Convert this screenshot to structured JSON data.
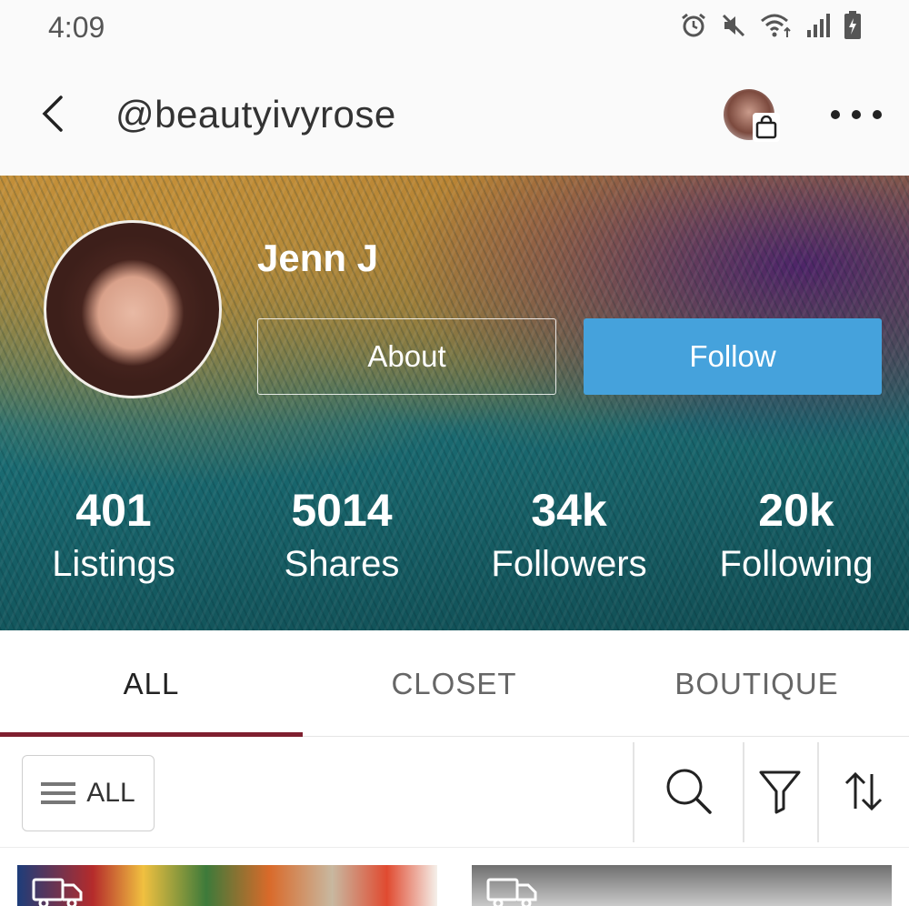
{
  "status_bar": {
    "time": "4:09",
    "icons": [
      "alarm-icon",
      "mute-icon",
      "wifi-icon",
      "signal-icon",
      "battery-charging-icon"
    ]
  },
  "header": {
    "handle": "@beautyivyrose",
    "icons": [
      "back-arrow-icon",
      "shopping-bag-icon",
      "more-options-icon"
    ]
  },
  "profile": {
    "name": "Jenn J",
    "about_label": "About",
    "follow_label": "Follow",
    "follow_color": "#45a2dc",
    "stats": [
      {
        "value": "401",
        "label": "Listings"
      },
      {
        "value": "5014",
        "label": "Shares"
      },
      {
        "value": "34k",
        "label": "Followers"
      },
      {
        "value": "20k",
        "label": "Following"
      }
    ]
  },
  "tabs": {
    "items": [
      {
        "label": "ALL",
        "active": true
      },
      {
        "label": "CLOSET",
        "active": false
      },
      {
        "label": "BOUTIQUE",
        "active": false
      }
    ],
    "active_color": "#7f1f2f"
  },
  "toolbar": {
    "filter_label": "ALL",
    "icons": [
      "menu-icon",
      "search-icon",
      "filter-funnel-icon",
      "sort-icon"
    ]
  },
  "listings": {
    "icons": [
      "shipping-truck-icon"
    ]
  }
}
